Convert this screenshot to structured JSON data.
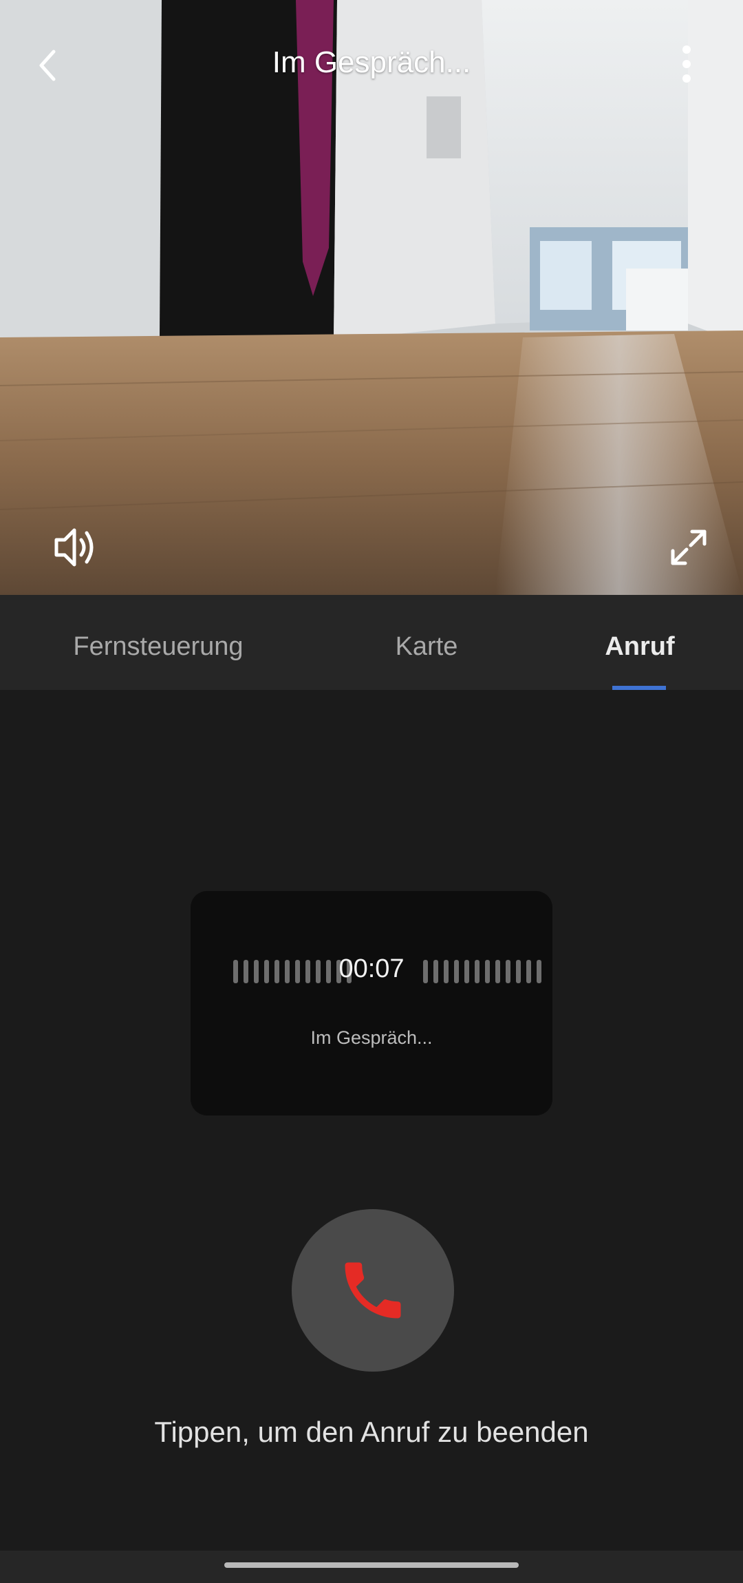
{
  "header": {
    "title": "Im Gespräch..."
  },
  "video": {
    "back_icon": "chevron-left-icon",
    "more_icon": "more-vertical-icon",
    "volume_icon": "speaker-volume-icon",
    "fullscreen_icon": "expand-icon"
  },
  "tabs": [
    {
      "label": "Fernsteuerung",
      "active": false
    },
    {
      "label": "Karte",
      "active": false
    },
    {
      "label": "Anruf",
      "active": true
    }
  ],
  "call": {
    "timer": "00:07",
    "status": "Im Gespräch...",
    "hangup_icon": "phone-hangup-icon",
    "hint": "Tippen, um den Anruf zu beenden"
  },
  "colors": {
    "background": "#1b1b1b",
    "tab_bar": "#262626",
    "tab_indicator": "#3f73d3",
    "hangup_icon": "#e52b25",
    "hangup_button": "#4a4a4a",
    "card": "#0d0d0d"
  }
}
